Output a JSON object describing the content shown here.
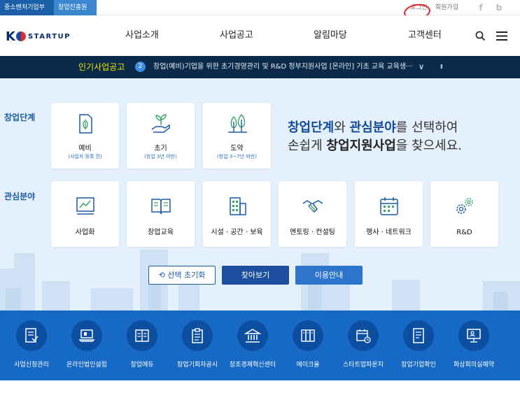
{
  "topbar": {
    "org1": "중소벤처기업부",
    "org2": "창업진흥원",
    "login": "로그인",
    "join": "회원가입",
    "facebook": "f",
    "blog": "b"
  },
  "header": {
    "logo_k": "K",
    "logo_text": "STARTUP",
    "menu": [
      "사업소개",
      "사업공고",
      "알림마당",
      "고객센터"
    ]
  },
  "notice": {
    "label": "인기사업공고",
    "number": "2",
    "title": "창업(예비)기업을 위한 초기경영관리 및 R&D 정부지원사업 [온라인] 기초 교육 교육생···",
    "chevron": "∨",
    "pause": "II"
  },
  "stage": {
    "label": "창업단계",
    "cards": [
      {
        "name": "예비",
        "sub": "(사업자 등록 전)",
        "icon": "document-leaf-icon"
      },
      {
        "name": "초기",
        "sub": "(창업 3년 미만)",
        "icon": "sprout-hand-icon"
      },
      {
        "name": "도약",
        "sub": "(창업 3~7년 미만)",
        "icon": "trees-icon"
      }
    ]
  },
  "headline": {
    "part1": "창업단계",
    "part2": "와 ",
    "part3": "관심분야",
    "part4": "를 선택하여",
    "part5": "손쉽게 ",
    "part6": "창업지원사업",
    "part7": "을 찾으세요."
  },
  "interest": {
    "label": "관심분야",
    "cards": [
      {
        "name": "사업화",
        "icon": "chart-board-icon"
      },
      {
        "name": "창업교육",
        "icon": "open-book-icon"
      },
      {
        "name": "시설 · 공간 · 보육",
        "icon": "building-icon"
      },
      {
        "name": "멘토링 · 컨설팅",
        "icon": "handshake-icon"
      },
      {
        "name": "행사 · 네트워크",
        "icon": "calendar-icon"
      },
      {
        "name": "R&D",
        "icon": "gears-icon"
      }
    ]
  },
  "buttons": {
    "reset": "선택 초기화",
    "search": "찾아보기",
    "guide": "이용안내"
  },
  "quick": [
    {
      "label": "사업신청관리",
      "icon": "application-icon"
    },
    {
      "label": "온라인법인설립",
      "icon": "laptop-icon"
    },
    {
      "label": "창업에듀",
      "icon": "book-icon"
    },
    {
      "label": "창업기회자공시",
      "icon": "clipboard-icon"
    },
    {
      "label": "창조경제혁신센터",
      "icon": "institution-icon"
    },
    {
      "label": "메이크올",
      "icon": "binders-icon"
    },
    {
      "label": "스타트업파운지",
      "icon": "calendar-clock-icon"
    },
    {
      "label": "창업기업확인",
      "icon": "certificate-icon"
    },
    {
      "label": "화상회의실예약",
      "icon": "video-conference-icon"
    }
  ],
  "colors": {
    "accent": "#1769c6",
    "dark_navy": "#0b2a4a",
    "notice_yellow": "#f2e500",
    "bg_light": "#e4f0fb"
  }
}
